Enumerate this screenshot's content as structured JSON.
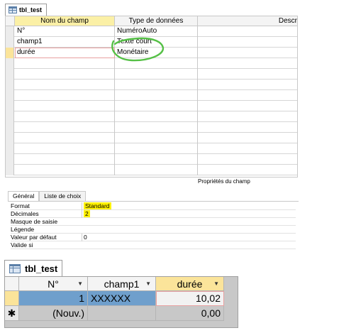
{
  "design_view": {
    "object_tab": "tbl_test",
    "columns": {
      "name": "Nom du champ",
      "type": "Type de données",
      "description": "Descr"
    },
    "fields": [
      {
        "name": "N°",
        "type": "NuméroAuto"
      },
      {
        "name": "champ1",
        "type": "Texte court"
      },
      {
        "name": "durée",
        "type": "Monétaire"
      }
    ],
    "properties_title": "Propriétés du champ"
  },
  "field_properties": {
    "tabs": [
      "Général",
      "Liste de choix"
    ],
    "rows": [
      {
        "key": "Format",
        "value": "Standard"
      },
      {
        "key": "Décimales",
        "value": "2"
      },
      {
        "key": "Masque de saisie",
        "value": ""
      },
      {
        "key": "Légende",
        "value": ""
      },
      {
        "key": "Valeur par défaut",
        "value": "0"
      },
      {
        "key": "Valide si",
        "value": ""
      }
    ]
  },
  "datasheet": {
    "object_tab": "tbl_test",
    "columns": [
      "N°",
      "champ1",
      "durée"
    ],
    "rows": [
      {
        "selector": "",
        "id": "1",
        "champ1": "XXXXXX",
        "duree": "10,02"
      },
      {
        "selector": "✱",
        "id": "(Nouv.)",
        "champ1": "",
        "duree": "0,00"
      }
    ]
  },
  "colors": {
    "selection_yellow": "#fbe49a",
    "highlight_yellow": "#fff200",
    "cell_blue": "#6f9fcc",
    "green_annotation": "#55c046"
  }
}
